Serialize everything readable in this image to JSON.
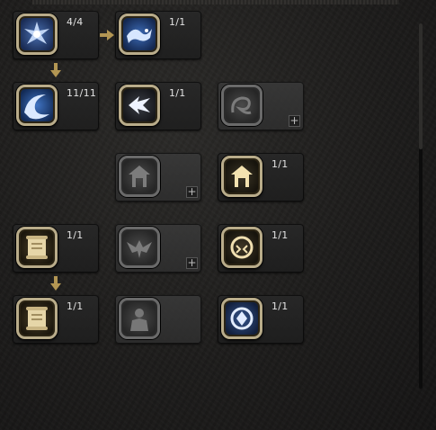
{
  "skill_tree": {
    "nodes": [
      {
        "id": "r1c1",
        "level": "4/4",
        "icon": "frost-spiral-icon",
        "state": "unlocked",
        "theme": "frost"
      },
      {
        "id": "r1c2",
        "level": "1/1",
        "icon": "frost-dragon-icon",
        "state": "unlocked",
        "theme": "frost"
      },
      {
        "id": "r2c1",
        "level": "11/11",
        "icon": "frost-wave-icon",
        "state": "unlocked",
        "theme": "frost"
      },
      {
        "id": "r2c2",
        "level": "1/1",
        "icon": "arrow-strike-icon",
        "state": "unlocked",
        "theme": "white"
      },
      {
        "id": "r2c3",
        "level": "",
        "icon": "serpent-icon",
        "state": "locked",
        "add_label": "+"
      },
      {
        "id": "r3c2",
        "level": "",
        "icon": "tower-icon",
        "state": "locked",
        "add_label": "+"
      },
      {
        "id": "r3c3",
        "level": "1/1",
        "icon": "tower-icon",
        "state": "unlocked",
        "theme": "gold"
      },
      {
        "id": "r4c1",
        "level": "1/1",
        "icon": "scroll-icon",
        "state": "unlocked",
        "theme": "parchment"
      },
      {
        "id": "r4c2",
        "level": "",
        "icon": "eagle-icon",
        "state": "locked",
        "add_label": "+"
      },
      {
        "id": "r4c3",
        "level": "1/1",
        "icon": "beast-icon",
        "state": "unlocked",
        "theme": "gold"
      },
      {
        "id": "r5c1",
        "level": "1/1",
        "icon": "scroll-icon",
        "state": "unlocked",
        "theme": "parchment"
      },
      {
        "id": "r5c2",
        "level": "",
        "icon": "warrior-icon",
        "state": "locked"
      },
      {
        "id": "r5c3",
        "level": "1/1",
        "icon": "crest-icon",
        "state": "unlocked",
        "theme": "frost"
      }
    ],
    "connectors": [
      {
        "type": "right",
        "from": "r1c1",
        "to": "r1c2",
        "icon": "connector-arrow-right-icon"
      },
      {
        "type": "down",
        "from": "r1c1",
        "to": "r2c1",
        "icon": "connector-arrow-down-icon"
      },
      {
        "type": "down",
        "from": "r4c1",
        "to": "r5c1",
        "icon": "connector-arrow-down-icon"
      }
    ],
    "colors": {
      "frost": "#9cc3ff",
      "gold": "#e8d398",
      "parchment": "#d9c79a",
      "locked": "#8a8a8a",
      "frame": "#b9ac8a",
      "connector": "#b39653"
    }
  }
}
